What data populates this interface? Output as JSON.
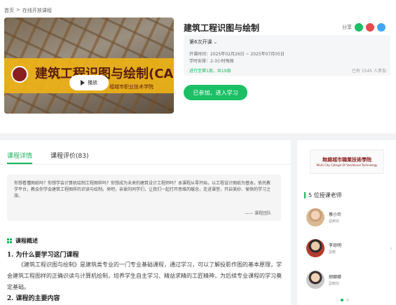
{
  "breadcrumb": [
    "首页",
    ">",
    "在线开放课程"
  ],
  "cover": {
    "title": "建筑工程识图与绘制(CAD)",
    "school": "福城市职业技术学院",
    "play_label": "播放"
  },
  "course": {
    "title": "建筑工程识图与绘制",
    "share_label": "分享",
    "term": "第6次开课",
    "term_chevron": "⌄",
    "dates": "开课时间：2025年02月26日 ~ 2025年07月05日",
    "study_time": "学时安排：2-3小时每周",
    "progress": "进行至第1周，共19周",
    "enrolled": "已有 1545 人参加",
    "join_label": "已参加，进入学习"
  },
  "tabs": [
    "课程详情",
    "课程评价(83)"
  ],
  "intro": {
    "text": "你想看懂图纸吗？你想学会计算机绘制工程图样吗？你想成为未来的建筑设计工程师吗？本课程从零开始，以工程设计图纸为基本，依托教学平台，教会你学会建筑工程图样的识读与绘制。来吧，亲爱的同学们，让我们一起打开思维的暖念，走进课堂，开启美妙、愉快的学习之旅。",
    "signature": "—— 课程团队"
  },
  "overview": {
    "heading": "课程概述",
    "q1": "1. 为什么要学习这门课程",
    "p1": "《建筑工程识图与绘制》是建筑类专业的一门专业基础课程，通过学习，可以了解投影作图的基本原理，学会建筑工程图样的正确识读与计算机绘制，培养学生自主学习、精益求精的工匠精神，为后续专业课程的学习奠定基础。",
    "q2": "2. 课程的主要内容"
  },
  "side": {
    "banner_cn": "無錫城市職業技術學院",
    "banner_en": "WuXi City College Of Vocational Technology",
    "teachers_heading": "5 位授课老师",
    "teachers": [
      {
        "name": "蔡小玲",
        "role": "副教授"
      },
      {
        "name": "李琼明",
        "role": "副教"
      },
      {
        "name": "胡娜娜",
        "role": "副教授"
      }
    ],
    "next_arrow": "›"
  },
  "colors": {
    "accent": "#1bc066"
  }
}
